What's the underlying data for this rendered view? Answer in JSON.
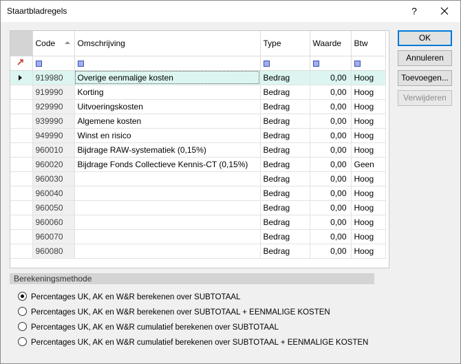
{
  "window": {
    "title": "Staartbladregels",
    "help_label": "?"
  },
  "grid": {
    "columns": {
      "code": "Code",
      "description": "Omschrijving",
      "type": "Type",
      "value": "Waarde",
      "vat": "Btw"
    },
    "rows": [
      {
        "code": "919980",
        "description": "Overige eenmalige kosten",
        "type": "Bedrag",
        "value": "0,00",
        "vat": "Hoog"
      },
      {
        "code": "919990",
        "description": "Korting",
        "type": "Bedrag",
        "value": "0,00",
        "vat": "Hoog"
      },
      {
        "code": "929990",
        "description": "Uitvoeringskosten",
        "type": "Bedrag",
        "value": "0,00",
        "vat": "Hoog"
      },
      {
        "code": "939990",
        "description": "Algemene kosten",
        "type": "Bedrag",
        "value": "0,00",
        "vat": "Hoog"
      },
      {
        "code": "949990",
        "description": "Winst en risico",
        "type": "Bedrag",
        "value": "0,00",
        "vat": "Hoog"
      },
      {
        "code": "960010",
        "description": "Bijdrage RAW-systematiek (0,15%)",
        "type": "Bedrag",
        "value": "0,00",
        "vat": "Hoog"
      },
      {
        "code": "960020",
        "description": "Bijdrage Fonds Collectieve Kennis-CT (0,15%)",
        "type": "Bedrag",
        "value": "0,00",
        "vat": "Geen"
      },
      {
        "code": "960030",
        "description": "",
        "type": "Bedrag",
        "value": "0,00",
        "vat": "Hoog"
      },
      {
        "code": "960040",
        "description": "",
        "type": "Bedrag",
        "value": "0,00",
        "vat": "Hoog"
      },
      {
        "code": "960050",
        "description": "",
        "type": "Bedrag",
        "value": "0,00",
        "vat": "Hoog"
      },
      {
        "code": "960060",
        "description": "",
        "type": "Bedrag",
        "value": "0,00",
        "vat": "Hoog"
      },
      {
        "code": "960070",
        "description": "",
        "type": "Bedrag",
        "value": "0,00",
        "vat": "Hoog"
      },
      {
        "code": "960080",
        "description": "",
        "type": "Bedrag",
        "value": "0,00",
        "vat": "Hoog"
      }
    ]
  },
  "buttons": {
    "ok": "OK",
    "cancel": "Annuleren",
    "add": "Toevoegen...",
    "remove": "Verwijderen"
  },
  "calculation": {
    "header": "Berekeningsmethode",
    "options": [
      {
        "label": "Percentages UK, AK en W&R berekenen over SUBTOTAAL",
        "checked": true
      },
      {
        "label": "Percentages UK, AK en W&R berekenen over SUBTOTAAL + EENMALIGE KOSTEN",
        "checked": false
      },
      {
        "label": "Percentages UK, AK en W&R cumulatief berekenen over SUBTOTAAL",
        "checked": false
      },
      {
        "label": "Percentages UK, AK en W&R cumulatief berekenen over SUBTOTAAL + EENMALIGE KOSTEN",
        "checked": false
      }
    ]
  }
}
